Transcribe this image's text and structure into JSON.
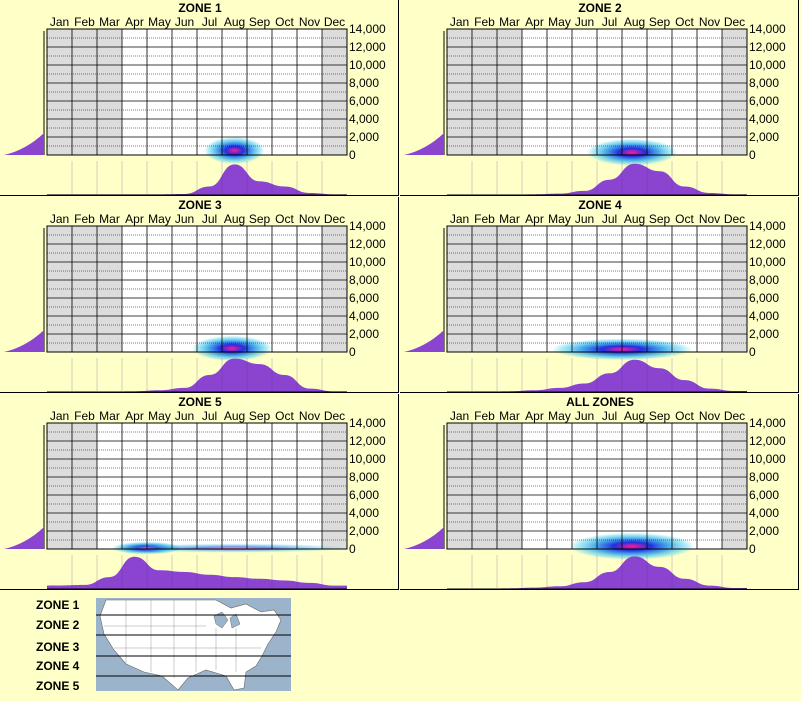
{
  "months": [
    "Jan",
    "Feb",
    "Mar",
    "Apr",
    "May",
    "Jun",
    "Jul",
    "Aug",
    "Sep",
    "Oct",
    "Nov",
    "Dec"
  ],
  "yticks": [
    "14,000",
    "12,000",
    "10,000",
    "8,000",
    "6,000",
    "4,000",
    "2,000",
    "0"
  ],
  "colors": {
    "background": "#ffffc8",
    "profile_fill": "#8a44d0",
    "heat_hot": "#ff1a9a",
    "heat_mid": "#2030e0",
    "heat_cool": "#60d8f0",
    "shade": "#dcdcdc"
  },
  "panels": [
    {
      "title": "ZONE 1",
      "shade_left": 3,
      "shade_right": 11,
      "heat": [
        {
          "x": 7.5,
          "y": 500,
          "rx": 1.2,
          "ry": 1500,
          "w": 1
        }
      ],
      "chart_data": {
        "type": "area",
        "x_axis": "month",
        "y_axis": "elevation_ft",
        "ylim": [
          0,
          14000
        ],
        "monthly_profile": [
          0.02,
          0.02,
          0.02,
          0.02,
          0.02,
          0.03,
          0.25,
          0.9,
          0.4,
          0.25,
          0.06,
          0.02
        ]
      }
    },
    {
      "title": "ZONE 2",
      "shade_left": 3,
      "shade_right": 11,
      "heat": [
        {
          "x": 7.4,
          "y": 300,
          "rx": 1.8,
          "ry": 1500,
          "w": 1
        }
      ],
      "chart_data": {
        "type": "area",
        "x_axis": "month",
        "y_axis": "elevation_ft",
        "ylim": [
          0,
          14000
        ],
        "monthly_profile": [
          0.01,
          0.01,
          0.01,
          0.02,
          0.04,
          0.12,
          0.45,
          0.92,
          0.7,
          0.25,
          0.06,
          0.02
        ]
      }
    },
    {
      "title": "ZONE 3",
      "shade_left": 3,
      "shade_right": 11,
      "heat": [
        {
          "x": 7.4,
          "y": 400,
          "rx": 1.6,
          "ry": 1400,
          "w": 1
        }
      ],
      "chart_data": {
        "type": "area",
        "x_axis": "month",
        "y_axis": "elevation_ft",
        "ylim": [
          0,
          14000
        ],
        "monthly_profile": [
          0.01,
          0.01,
          0.01,
          0.02,
          0.05,
          0.12,
          0.5,
          0.98,
          0.82,
          0.5,
          0.1,
          0.02
        ]
      }
    },
    {
      "title": "ZONE 4",
      "shade_left": 3,
      "shade_right": 11,
      "heat": [
        {
          "x": 7.0,
          "y": 300,
          "rx": 2.8,
          "ry": 1200,
          "w": 1
        }
      ],
      "chart_data": {
        "type": "area",
        "x_axis": "month",
        "y_axis": "elevation_ft",
        "ylim": [
          0,
          14000
        ],
        "monthly_profile": [
          0.01,
          0.01,
          0.02,
          0.05,
          0.12,
          0.25,
          0.55,
          0.95,
          0.7,
          0.35,
          0.1,
          0.03
        ]
      }
    },
    {
      "title": "ZONE 5",
      "shade_left": 2,
      "shade_right": 11,
      "heat": [
        {
          "x": 4.0,
          "y": 100,
          "rx": 1.4,
          "ry": 700,
          "w": 1
        },
        {
          "x": 7.5,
          "y": 100,
          "rx": 4.5,
          "ry": 500,
          "w": 0.55
        }
      ],
      "chart_data": {
        "type": "area",
        "x_axis": "month",
        "y_axis": "elevation_ft",
        "ylim": [
          0,
          14000
        ],
        "monthly_profile": [
          0.1,
          0.12,
          0.35,
          0.95,
          0.55,
          0.5,
          0.42,
          0.35,
          0.3,
          0.25,
          0.18,
          0.1
        ]
      }
    },
    {
      "title": "ALL ZONES",
      "shade_left": 3,
      "shade_right": 11,
      "heat": [
        {
          "x": 7.4,
          "y": 300,
          "rx": 2.5,
          "ry": 1500,
          "w": 1
        }
      ],
      "chart_data": {
        "type": "area",
        "x_axis": "month",
        "y_axis": "elevation_ft",
        "ylim": [
          0,
          14000
        ],
        "monthly_profile": [
          0.01,
          0.01,
          0.02,
          0.04,
          0.08,
          0.2,
          0.5,
          0.96,
          0.65,
          0.3,
          0.1,
          0.03
        ]
      }
    }
  ],
  "legend": {
    "zones": [
      "ZONE 1",
      "ZONE 2",
      "ZONE 3",
      "ZONE 4",
      "ZONE 5"
    ]
  }
}
